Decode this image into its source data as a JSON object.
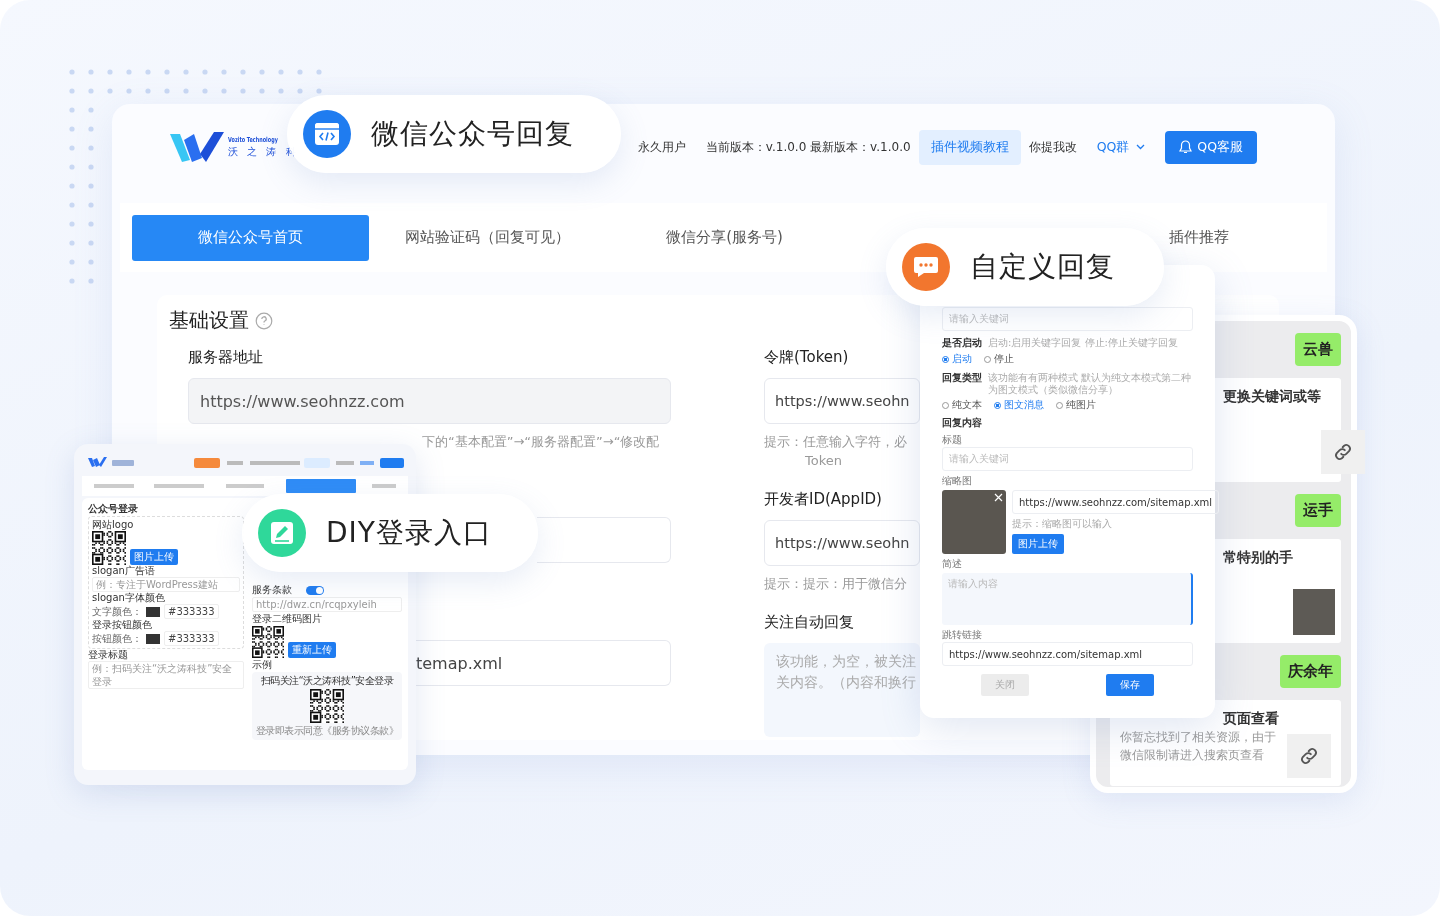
{
  "header": {
    "logo_name": "Vozito Technology",
    "logo_subtitle": "沃 之 涛 科",
    "nav": [
      {
        "label": "永久用户",
        "kind": "text"
      },
      {
        "label": "当前版本：v.1.0.0  最新版本：v.1.0.0",
        "kind": "text"
      },
      {
        "label": "插件视频教程",
        "kind": "highlight"
      },
      {
        "label": "你提我改",
        "kind": "text"
      },
      {
        "label": "QQ群",
        "kind": "dropdown"
      },
      {
        "label": "QQ客服",
        "kind": "primary"
      }
    ]
  },
  "tabs": [
    {
      "label": "微信公众号首页",
      "selected": true
    },
    {
      "label": "网站验证码（回复可见）",
      "selected": false
    },
    {
      "label": "微信分享(服务号)",
      "selected": false
    },
    {
      "label": "插件推荐",
      "selected": false
    }
  ],
  "settings": {
    "title": "基础设置",
    "left": {
      "label": "服务器地址",
      "value": "https://www.seohnzz.com",
      "hint": "下的“基本配置”→“服务器配置”→“修改配",
      "last_value": "temap.xml"
    },
    "right": {
      "token_label": "令牌(Token)",
      "token_value": "https://www.seohn",
      "token_hint": [
        "提示：任意输入字符，必",
        "Token"
      ],
      "appid_label": "开发者ID(AppID)",
      "appid_value": "https://www.seohn",
      "appid_hint": "提示：提示：用于微信分",
      "follow_label": "关注自动回复",
      "follow_placeholder": [
        "该功能，为空，被关注",
        "关内容。（内容和换行"
      ]
    }
  },
  "callouts": [
    {
      "label": "微信公众号回复",
      "kind": "code"
    },
    {
      "label": "自定义回复",
      "kind": "chat"
    },
    {
      "label": "DIY登录入口",
      "kind": "edit"
    }
  ],
  "dialog": {
    "keyword_placeholder": "请输入关键词",
    "enable_label": "是否启动",
    "enable_hint": "启动:启用关键字回复   停止:停止关键字回复",
    "enable_options": [
      {
        "label": "启动",
        "selected": true
      },
      {
        "label": "停止",
        "selected": false
      }
    ],
    "type_label": "回复类型",
    "type_hint": "该功能有有两种模式 默认为纯文本模式第二种为图文模式（类似微信分享）",
    "type_options": [
      {
        "label": "纯文本",
        "selected": false
      },
      {
        "label": "图文消息",
        "selected": true
      },
      {
        "label": "纯图片",
        "selected": false
      }
    ],
    "content_label": "回复内容",
    "title_label": "标题",
    "title_placeholder": "请输入关键词",
    "thumb_label": "缩略图",
    "thumb_url": "https://www.seohnzz.com/sitemap.xml",
    "thumb_hint": "提示：缩略图可以输入",
    "upload": "图片上传",
    "summary_label": "简述",
    "summary_placeholder": "请输入内容",
    "link_label": "跳转链接",
    "link_value": "https://www.seohnzz.com/sitemap.xml",
    "buttons": [
      {
        "label": "关闭",
        "kind": "secondary"
      },
      {
        "label": "保存",
        "kind": "primary"
      }
    ]
  },
  "chat": [
    {
      "kind": "bubble",
      "text": "云兽"
    },
    {
      "kind": "link_card",
      "title": "更换关键词或等"
    },
    {
      "kind": "bubble",
      "text": "运手"
    },
    {
      "kind": "photo_card",
      "title": "常特别的手"
    },
    {
      "kind": "bubble",
      "text": "庆余年"
    },
    {
      "kind": "link_card",
      "title": "页面查看",
      "lines": [
        "你暂忘找到了相关资源，由于",
        "微信限制请进入搜索页查看"
      ]
    }
  ],
  "mini": {
    "title": "公众号登录",
    "logo_label": "网站logo",
    "upload": "图片上传",
    "slogan_label": "slogan广告语",
    "slogan_placeholder": "例：专注于WordPress建站",
    "slogan_color_label": "slogan字体颜色",
    "color_rows": [
      {
        "label": "文字颜色：",
        "value": "#333333",
        "color": "#333333"
      }
    ],
    "button_color_label": "登录按钮颜色",
    "button_rows": [
      {
        "label": "按钮颜色：",
        "value": "#333333",
        "color": "#333333"
      }
    ],
    "login_title_label": "登录标题",
    "login_title_placeholder": "例：扫码关注“沃之涛科技”安全登录",
    "terms_label": "服务条款",
    "terms_on": true,
    "terms_url": "http://dwz.cn/rcqpxyleih",
    "qr_label": "登录二维码图片",
    "reupload": "重新上传",
    "example_label": "示例",
    "example_caption": "扫码关注“沃之涛科技”安全登录",
    "example_footer": "登录即表示同意《服务协议条款》"
  }
}
